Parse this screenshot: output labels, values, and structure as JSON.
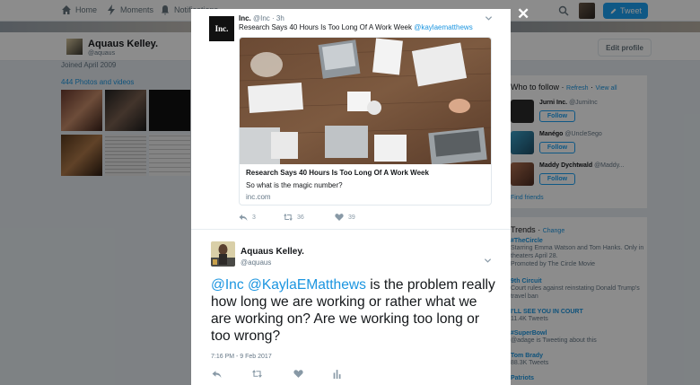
{
  "nav": {
    "home_label": "Home",
    "moments_label": "Moments",
    "notifications_label": "Notifications",
    "tweet_button_label": "Tweet"
  },
  "profile": {
    "name": "Aquaus Kelley.",
    "handle": "@aquaus",
    "edit_label": "Edit profile",
    "joined": "Joined April 2009",
    "photos_label": "444 Photos and videos"
  },
  "who_to_follow": {
    "title": "Who to follow",
    "refresh": "Refresh",
    "view_all": "View all",
    "follow_label": "Follow",
    "find_friends": "Find friends",
    "accounts": [
      {
        "name": "Jurni Inc.",
        "handle": "@JurniInc"
      },
      {
        "name": "Manégo",
        "handle": "@UncleSego"
      },
      {
        "name": "Maddy Dychtwald",
        "handle": "@Maddy..."
      }
    ]
  },
  "trends": {
    "title": "Trends",
    "change": "Change",
    "items": [
      {
        "name": "#TheCircle",
        "desc": "Starring Emma Watson and Tom Hanks. Only in theaters April 28.",
        "meta": "Promoted by The Circle Movie"
      },
      {
        "name": "9th Circuit",
        "desc": "Court rules against reinstating Donald Trump's travel ban",
        "meta": ""
      },
      {
        "name": "I'LL SEE YOU IN COURT",
        "desc": "11.4K Tweets",
        "meta": ""
      },
      {
        "name": "#SuperBowl",
        "desc": "@adage is Tweeting about this",
        "meta": ""
      },
      {
        "name": "Tom Brady",
        "desc": "88.3K Tweets",
        "meta": ""
      },
      {
        "name": "Patriots",
        "desc": "",
        "meta": ""
      }
    ]
  },
  "modal": {
    "close_symbol": "✕",
    "quoted": {
      "logo_text": "Inc.",
      "author": "Inc.",
      "handle": "@Inc",
      "time": "· 3h",
      "text_before": "Research Says 40 Hours Is Too Long Of A Work Week ",
      "mention": "@kaylaematthews",
      "card_title": "Research Says 40 Hours Is Too Long Of A Work Week",
      "card_desc": "So what is the magic number?",
      "card_domain": "inc.com",
      "reply_count": "3",
      "retweet_count": "36",
      "like_count": "39"
    },
    "reply": {
      "name": "Aquaus Kelley.",
      "handle": "@aquaus",
      "mention1": "@Inc",
      "mention2": "@KaylaEMatthews",
      "text": " is the problem really how long we are working or rather what we are working on? Are we working too long or too wrong?",
      "datetime": "7:16 PM - 9 Feb 2017"
    }
  }
}
